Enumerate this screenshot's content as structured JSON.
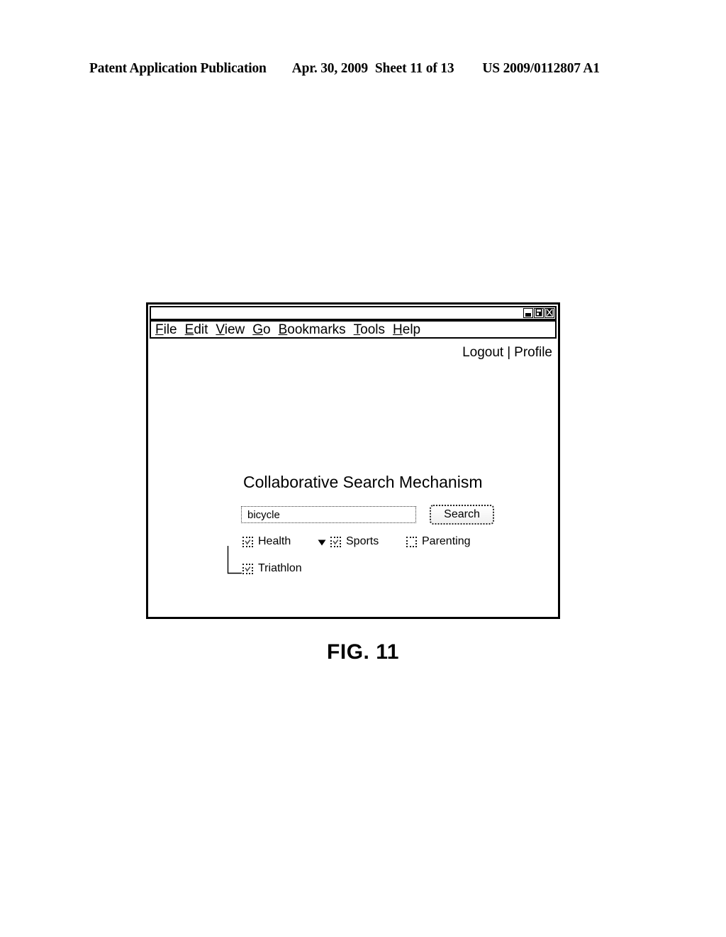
{
  "patent_header": {
    "publication": "Patent Application Publication",
    "date": "Apr. 30, 2009",
    "sheet": "Sheet 11 of 13",
    "document_number": "US 2009/0112807 A1"
  },
  "figure": {
    "caption": "FIG. 11"
  },
  "window": {
    "title": "",
    "controls": [
      {
        "name": "minimize",
        "label": "_"
      },
      {
        "name": "maximize",
        "label": "▣"
      },
      {
        "name": "close",
        "label": "X"
      }
    ],
    "menubar": [
      {
        "accel": "F",
        "rest": "ile"
      },
      {
        "accel": "E",
        "rest": "dit"
      },
      {
        "accel": "V",
        "rest": "iew"
      },
      {
        "accel": "G",
        "rest": "o"
      },
      {
        "accel": "B",
        "rest": "ookmarks"
      },
      {
        "accel": "T",
        "rest": "ools"
      },
      {
        "accel": "H",
        "rest": "elp"
      }
    ]
  },
  "account": {
    "logout_label": "Logout",
    "separator": "|",
    "profile_label": "Profile"
  },
  "page": {
    "title": "Collaborative Search Mechanism"
  },
  "search": {
    "query": "bicycle",
    "placeholder": "",
    "button_label": "Search"
  },
  "categories": [
    {
      "label": "Health",
      "checked": true,
      "expanded": true
    },
    {
      "label": "Sports",
      "checked": true,
      "expanded": false
    },
    {
      "label": "Parenting",
      "checked": false,
      "expanded": false
    }
  ],
  "subcategories": [
    {
      "label": "Triathlon",
      "checked": true,
      "parent": "Health"
    }
  ],
  "colors": {
    "ink": "#000000",
    "paper": "#ffffff",
    "control_border": "#1a1a1a"
  }
}
